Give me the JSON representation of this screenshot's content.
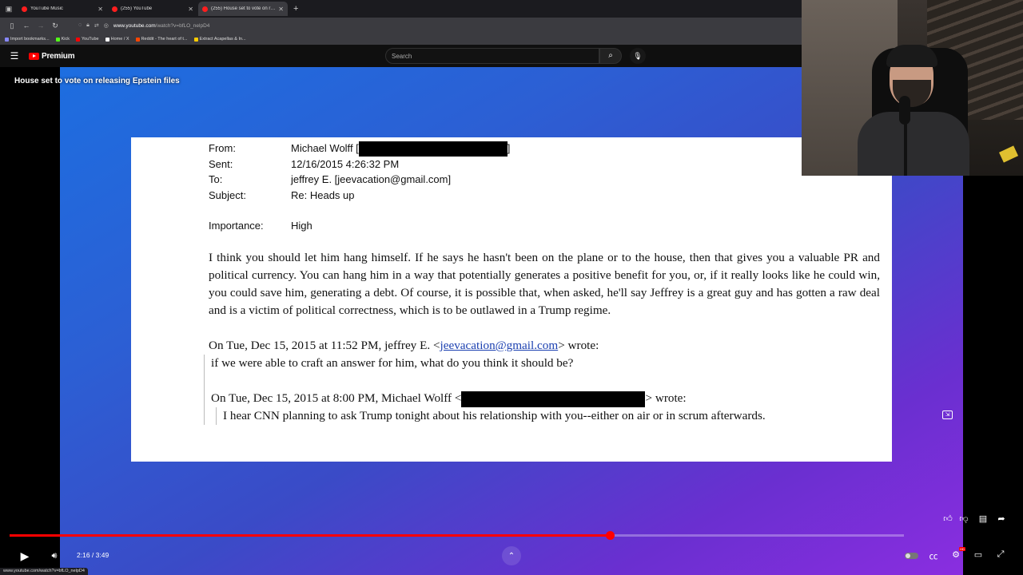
{
  "browser": {
    "tabs": [
      {
        "title": "YouTube Music",
        "active": false
      },
      {
        "title": "(255) YouTube",
        "active": false
      },
      {
        "title": "(255) House set to vote on relea",
        "active": true
      }
    ],
    "url_host": "www.youtube.com",
    "url_path": "/watch?v=bfLO_nelpD4",
    "bookmarks": [
      {
        "label": "Import bookmarks...",
        "color": "#8888ff"
      },
      {
        "label": "Kick",
        "color": "#53fc18"
      },
      {
        "label": "YouTube",
        "color": "#ff0000"
      },
      {
        "label": "Home / X",
        "color": "#ffffff"
      },
      {
        "label": "Reddit - The heart of t...",
        "color": "#ff4500"
      },
      {
        "label": "Extract Acapellas & In...",
        "color": "#ffcc00"
      }
    ],
    "status_url": "www.youtube.com/watch?v=bfLO_nelpD4"
  },
  "youtube": {
    "logo_text": "Premium",
    "search_placeholder": "Search"
  },
  "video": {
    "title": "House set to vote on releasing Epstein files",
    "current_time": "2:16",
    "duration": "3:49",
    "time_display": "2:16 / 3:49",
    "progress": 0.671
  },
  "email": {
    "headers": [
      {
        "key": "From:",
        "value": "Michael Wolff [",
        "suffix": "]",
        "redacted": true
      },
      {
        "key": "Sent:",
        "value": "12/16/2015 4:26:32 PM"
      },
      {
        "key": "To:",
        "value": "jeffrey E. [jeevacation@gmail.com]"
      },
      {
        "key": "Subject:",
        "value": "Re: Heads up"
      }
    ],
    "importance_key": "Importance:",
    "importance_value": "High",
    "paragraph": "I think you should let him hang himself. If he says he hasn't been on the plane or to the house, then that gives you a valuable PR and political currency. You can hang him in a way that potentially generates a positive benefit for you, or, if it really looks like he could win, you could save him, generating a debt. Of course, it is possible that, when asked, he'll say Jeffrey is a great guy and has gotten a raw deal and is a victim of political correctness, which is to be outlawed in a Trump regime.",
    "reply1_prefix": "On Tue, Dec 15, 2015 at 11:52 PM, jeffrey E. <",
    "reply1_link": "jeevacation@gmail.com",
    "reply1_suffix": "> wrote:",
    "reply1_body": "if we were able to craft an answer for him,  what do you think it should be?",
    "reply2_prefix": "On Tue, Dec 15, 2015 at 8:00 PM, Michael Wolff <",
    "reply2_suffix": "> wrote:",
    "reply2_body": "I hear CNN planning to ask Trump tonight about his relationship with you--either on air or in scrum afterwards."
  },
  "colors": {
    "progress": "#ff0000",
    "brand": "#ff0000"
  }
}
